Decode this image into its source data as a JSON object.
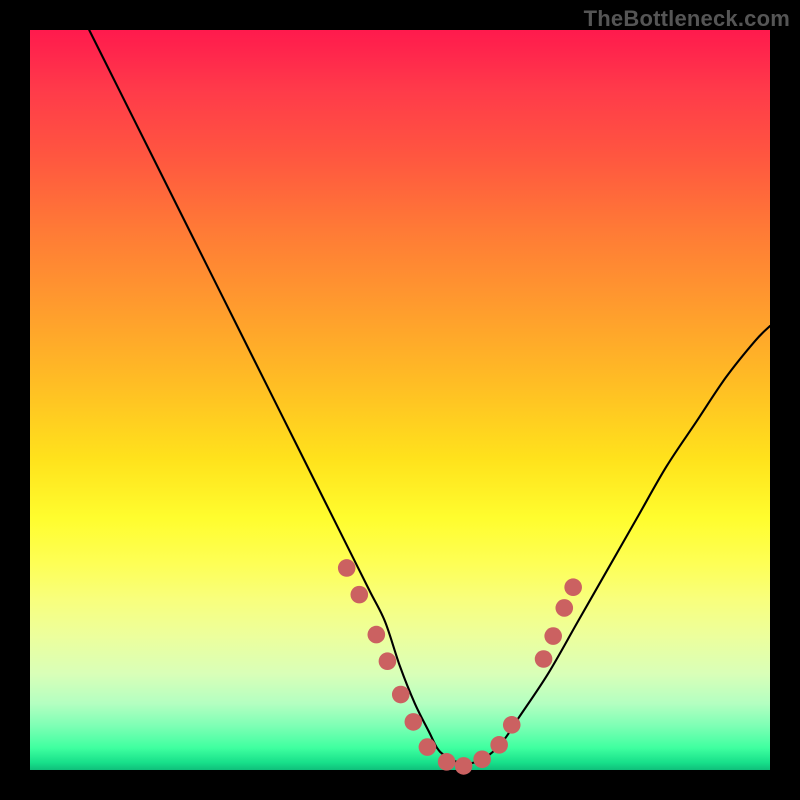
{
  "watermark": "TheBottleneck.com",
  "chart_data": {
    "type": "line",
    "title": "",
    "xlabel": "",
    "ylabel": "",
    "xlim": [
      0,
      100
    ],
    "ylim": [
      0,
      100
    ],
    "series": [
      {
        "name": "curve",
        "x": [
          8,
          12,
          16,
          20,
          24,
          28,
          32,
          36,
          40,
          44,
          46,
          48,
          50,
          52,
          54,
          55,
          56,
          58,
          60,
          62,
          64,
          66,
          70,
          74,
          78,
          82,
          86,
          90,
          94,
          98,
          100
        ],
        "values": [
          100,
          92,
          84,
          76,
          68,
          60,
          52,
          44,
          36,
          28,
          24,
          20,
          14,
          9,
          5,
          3,
          2,
          1,
          1,
          2,
          4,
          7,
          13,
          20,
          27,
          34,
          41,
          47,
          53,
          58,
          60
        ]
      }
    ],
    "markers": [
      {
        "x": 42.8,
        "y": 27.3
      },
      {
        "x": 44.5,
        "y": 23.7
      },
      {
        "x": 46.8,
        "y": 18.3
      },
      {
        "x": 48.3,
        "y": 14.7
      },
      {
        "x": 50.1,
        "y": 10.2
      },
      {
        "x": 51.8,
        "y": 6.5
      },
      {
        "x": 53.7,
        "y": 3.1
      },
      {
        "x": 56.3,
        "y": 1.1
      },
      {
        "x": 58.6,
        "y": 0.55
      },
      {
        "x": 61.1,
        "y": 1.45
      },
      {
        "x": 63.4,
        "y": 3.4
      },
      {
        "x": 65.1,
        "y": 6.1
      },
      {
        "x": 69.4,
        "y": 15.0
      },
      {
        "x": 70.7,
        "y": 18.1
      },
      {
        "x": 72.2,
        "y": 21.9
      },
      {
        "x": 73.4,
        "y": 24.7
      }
    ],
    "marker_color": "#CB6161",
    "curve_color": "#000000"
  }
}
